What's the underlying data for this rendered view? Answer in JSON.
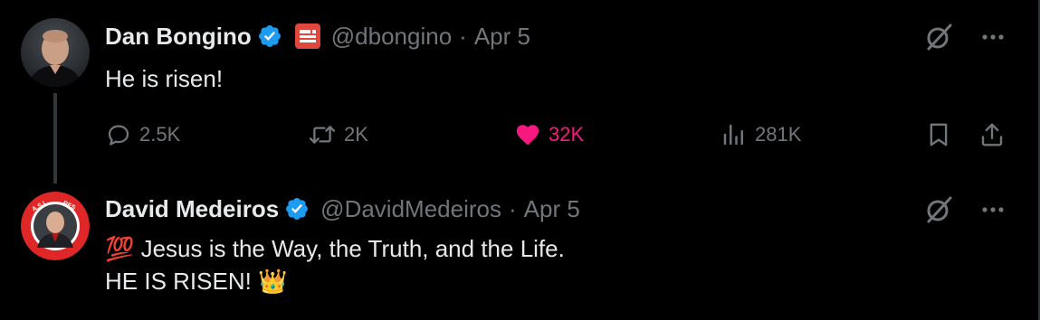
{
  "colors": {
    "background": "#000000",
    "text_primary": "#e7e9ea",
    "text_secondary": "#71767b",
    "verified_blue": "#1d9bf0",
    "like_pink": "#f91880",
    "affiliate_red": "#e0483e"
  },
  "tweets": [
    {
      "author": {
        "name": "Dan Bongino",
        "handle": "@dbongino",
        "verified": true,
        "affiliate_badge": "news-badge-icon"
      },
      "separator": "·",
      "date": "Apr 5",
      "text": "He is risen!",
      "stats": {
        "replies": "2.5K",
        "reposts": "2K",
        "likes": "32K",
        "views": "281K"
      },
      "liked": true
    },
    {
      "author": {
        "name": "David Medeiros",
        "handle": "@DavidMedeiros",
        "verified": true
      },
      "separator": "·",
      "date": "Apr 5",
      "text_line1": "💯 Jesus is the Way, the Truth, and the Life.",
      "text_line2": "HE IS RISEN! 👑"
    }
  ]
}
